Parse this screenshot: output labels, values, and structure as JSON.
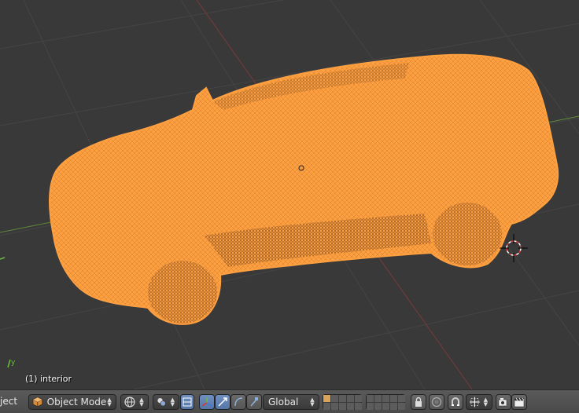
{
  "viewport": {
    "object_label": "(1) interior",
    "background": "#393939",
    "wire_color": "#ffa040"
  },
  "header": {
    "menu_fragment": "ject",
    "mode": {
      "label": "Object Mode",
      "icon": "cube-icon"
    },
    "viewport_shading_icon": "sphere-shading-icon",
    "pivot_icon": "pivot-point-icon",
    "manipulator_icons": [
      "manipulator-toggle-icon",
      "translate-icon",
      "rotate-icon",
      "scale-icon"
    ],
    "orientation": {
      "label": "Global"
    },
    "layers": {
      "active_index": 0
    },
    "right_icons": [
      "lock-icon",
      "proportional-edit-icon",
      "snap-icon",
      "snap-element-icon",
      "render-icon",
      "clapperboard-icon"
    ]
  }
}
